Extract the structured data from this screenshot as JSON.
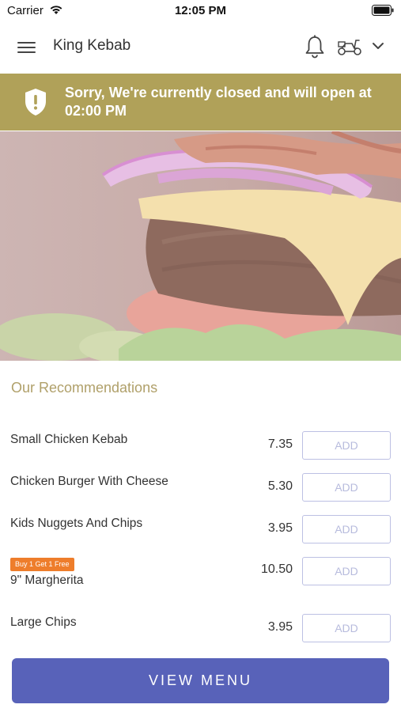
{
  "status_bar": {
    "carrier": "Carrier",
    "time": "12:05 PM"
  },
  "nav": {
    "title": "King Kebab"
  },
  "banner": {
    "message": "Sorry, We're currently closed and will open at 02:00 PM",
    "color": "#b0a159"
  },
  "recommendations": {
    "title": "Our Recommendations",
    "items": [
      {
        "name": "Small Chicken Kebab",
        "price": "7.35",
        "button": "ADD"
      },
      {
        "name": "Chicken Burger With Cheese",
        "price": "5.30",
        "button": "ADD"
      },
      {
        "name": "Kids Nuggets And Chips",
        "price": "3.95",
        "button": "ADD"
      },
      {
        "name": "9\" Margherita",
        "price": "10.50",
        "button": "ADD",
        "badge": "Buy 1 Get 1 Free"
      },
      {
        "name": "Large Chips",
        "price": "3.95",
        "button": "ADD"
      }
    ]
  },
  "footer": {
    "button": "VIEW MENU",
    "color": "#5862b9"
  },
  "icons": [
    "wifi-icon",
    "battery-icon",
    "menu-icon",
    "bell-icon",
    "scooter-icon",
    "chevron-down-icon",
    "shield-alert-icon"
  ]
}
